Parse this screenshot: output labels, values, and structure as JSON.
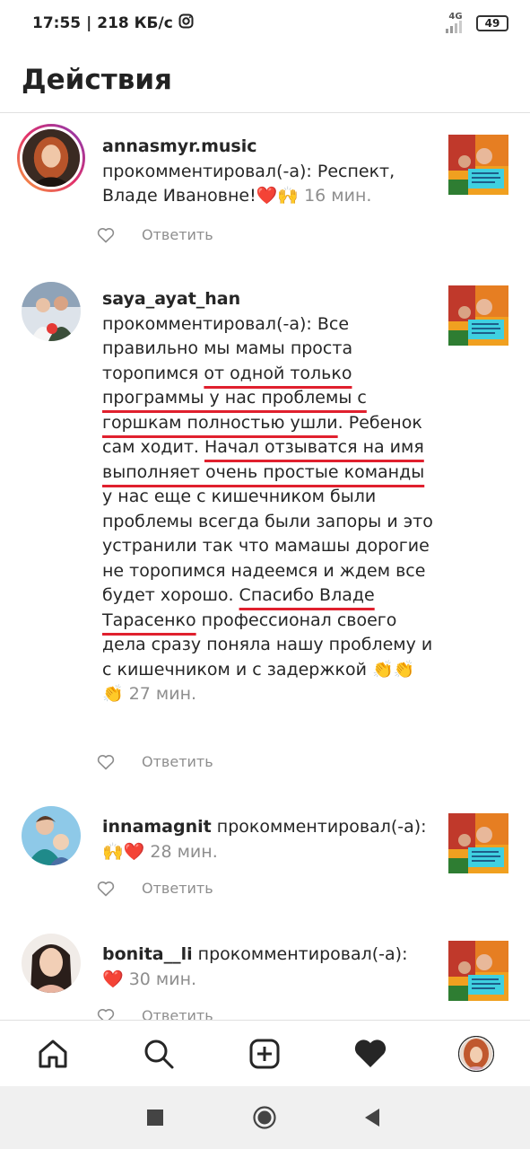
{
  "status_bar": {
    "time": "17:55",
    "speed": "| 218 КБ/с",
    "network": "4G",
    "battery": "49",
    "icons": [
      "instagram-icon",
      "signal-icon",
      "battery-icon"
    ]
  },
  "header": {
    "title": "Действия"
  },
  "notifications": [
    {
      "username": "annasmyr.music",
      "action": "прокомментировал(-а):",
      "comment": "Респект, Владе Ивановне!",
      "emoji": "❤️🙌",
      "time": "16 мин.",
      "reply_label": "Ответить"
    },
    {
      "username": "saya_ayat_han",
      "action": "прокомментировал(-а):",
      "comment_parts": [
        "Все правильно мы мамы проста торопимся ",
        "от одной только программы у нас проблемы с горшкам полностью ушли",
        ". Ребенок сам ходит. ",
        "Начал отзыватся на имя выполняет очень простые команды",
        " у нас еще с кишечником были проблемы всегда были запоры и это устранили так что мамашы дорогие не торопимся надеемся и ждем все будет хорошо. ",
        "Спасибо Владе Тарасенко",
        " профессионал своего дела сразу поняла нашу проблему и с кишечником и с задержкой "
      ],
      "emoji": "👏👏👏",
      "time": "27 мин.",
      "reply_label": "Ответить"
    },
    {
      "username": "innamagnit",
      "action": "прокомментировал(-а):",
      "emoji": "🙌❤️",
      "time": "28 мин.",
      "reply_label": "Ответить"
    },
    {
      "username": "bonita__li",
      "action": "прокомментировал(-а):",
      "emoji": "❤️",
      "time": "30 мин.",
      "reply_label": "Ответить"
    }
  ],
  "bottom_nav": {
    "items": [
      "home-icon",
      "search-icon",
      "create-post-icon",
      "activity-heart-icon",
      "profile-avatar"
    ],
    "active": "activity-heart-icon"
  },
  "system_nav": [
    "recents-square-icon",
    "home-circle-icon",
    "back-triangle-icon"
  ],
  "colors": {
    "underline": "#e0202e",
    "secondary_text": "#8e8e8e",
    "heart": "#ed4956"
  }
}
